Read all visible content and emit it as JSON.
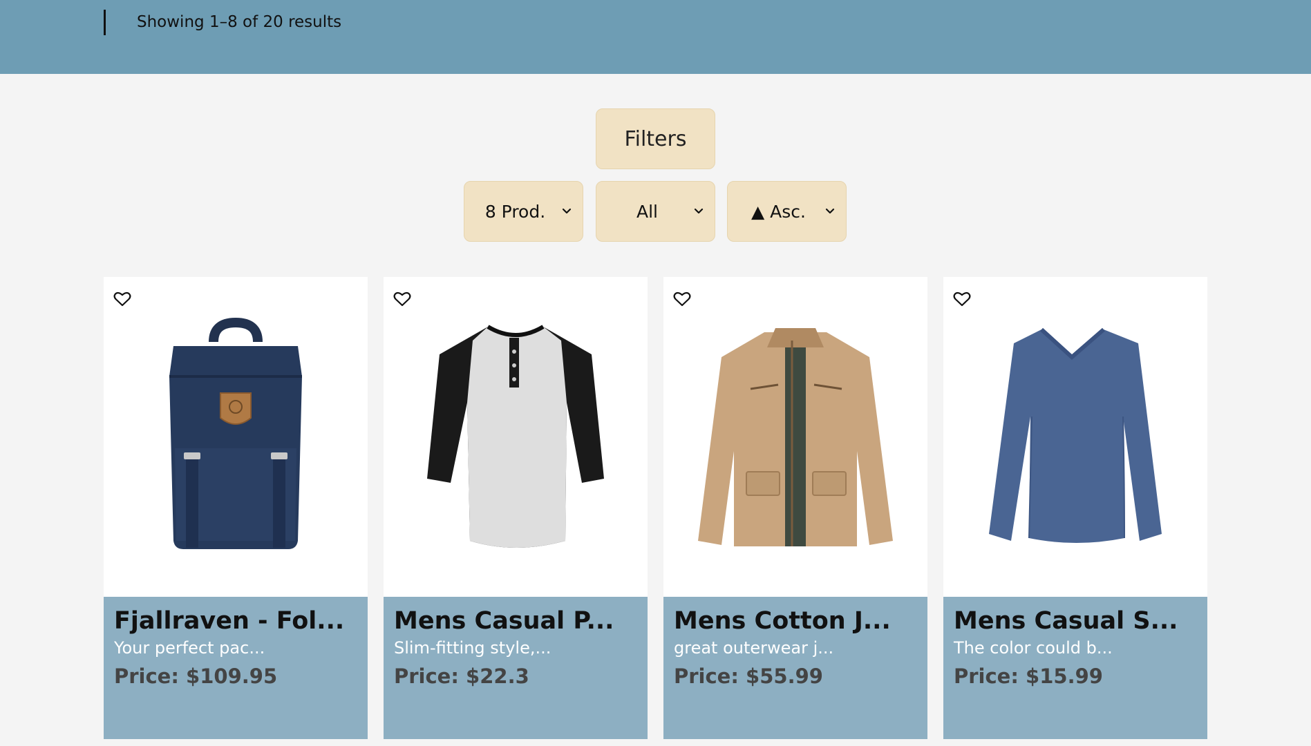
{
  "header": {
    "result_count": "Showing 1–8 of 20 results"
  },
  "controls": {
    "filters_label": "Filters",
    "per_page": {
      "value": "8 Prod.",
      "icon": "chevron-down-icon"
    },
    "category": {
      "value": "All",
      "icon": "chevron-down-icon"
    },
    "sort": {
      "value": "▲ Asc.",
      "icon": "chevron-down-icon"
    }
  },
  "colors": {
    "header_bg": "#6e9db4",
    "button_bg": "#f1e2c4",
    "card_info_bg": "#8dafc2"
  },
  "products": [
    {
      "title": "Fjallraven - Fol...",
      "desc": "Your perfect pac...",
      "price": "Price: $109.95",
      "image": "navy-backpack",
      "fav_icon": "heart-icon"
    },
    {
      "title": "Mens Casual P...",
      "desc": "Slim-fitting style,...",
      "price": "Price: $22.3",
      "image": "raglan-henley-shirt",
      "fav_icon": "heart-icon"
    },
    {
      "title": "Mens Cotton J...",
      "desc": "great outerwear j...",
      "price": "Price: $55.99",
      "image": "khaki-jacket",
      "fav_icon": "heart-icon"
    },
    {
      "title": "Mens Casual S...",
      "desc": "The color could b...",
      "price": "Price: $15.99",
      "image": "blue-longsleeve-shirt",
      "fav_icon": "heart-icon"
    }
  ]
}
